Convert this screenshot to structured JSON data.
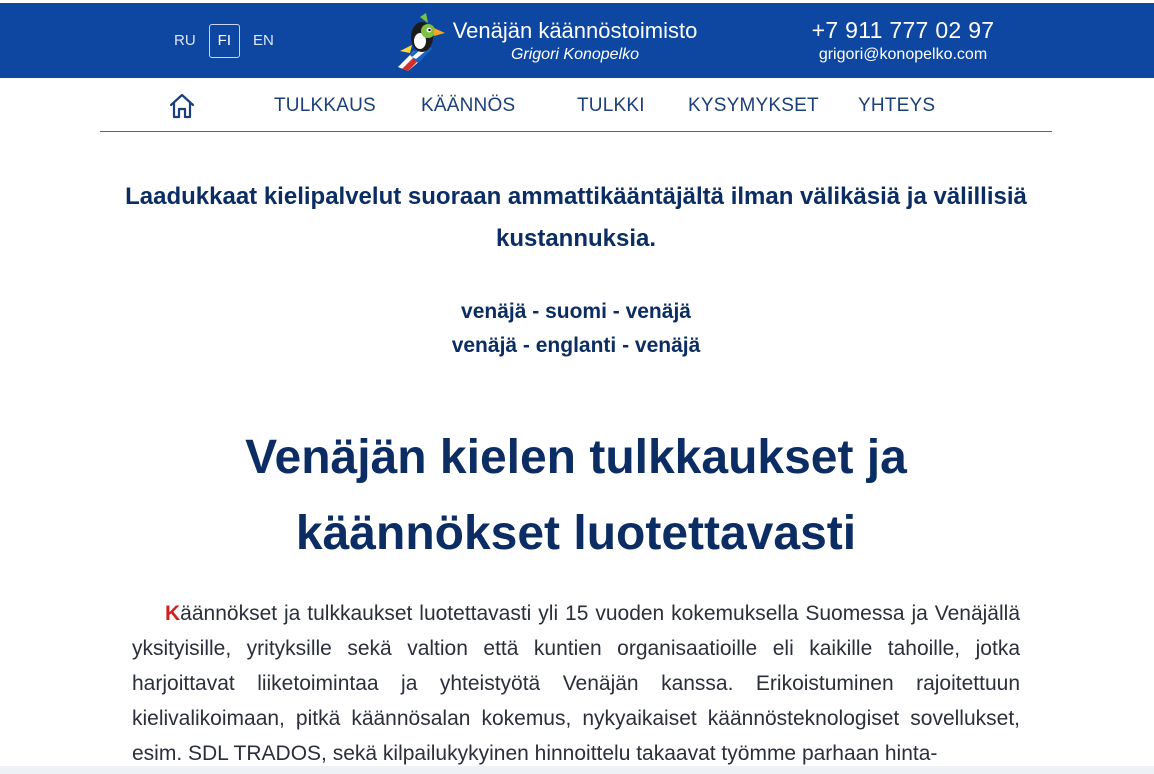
{
  "header": {
    "languages": [
      {
        "code": "RU",
        "active": false
      },
      {
        "code": "FI",
        "active": true
      },
      {
        "code": "EN",
        "active": false
      }
    ],
    "brand_name": "Venäjän käännöstoimisto",
    "brand_sub": "Grigori Konopelko",
    "phone": "+7 911 777 02 97",
    "email": "grigori@konopelko.com",
    "bg_color": "#0d47a1"
  },
  "nav": {
    "home_icon": "home-icon",
    "items": [
      {
        "label": "TULKKAUS"
      },
      {
        "label": "KÄÄNNÖS"
      },
      {
        "label": "TULKKI"
      },
      {
        "label": "KYSYMYKSET"
      },
      {
        "label": "YHTEYS"
      }
    ]
  },
  "main": {
    "lead": "Laadukkaat kielipalvelut suoraan ammattikääntäjältä ilman välikäsiä ja välillisiä kustannuksia.",
    "pair1": "venäjä - suomi - venäjä",
    "pair2": "venäjä - englanti - venäjä",
    "title": "Venäjän kielen tulkkaukset ja käännökset luotettavasti",
    "dropcap": "K",
    "paragraph": "äännökset ja tulkkaukset luotettavasti yli 15 vuoden kokemuksella Suomessa ja Venäjällä yksityisille, yrityksille sekä valtion että kuntien organisaatioille eli kaikille tahoille, jotka harjoittavat liiketoimintaa ja yhteistyötä Venäjän kanssa. Erikoistuminen rajoitettuun kielivalikoimaan, pitkä käännösalan kokemus, nykyaikaiset käännösteknologiset sovellukset, esim. SDL TRADOS, sekä kilpailukykyinen hinnoittelu takaavat työmme parhaan hinta-",
    "accent_color": "#d21f1f",
    "text_color": "#0b2d63"
  }
}
